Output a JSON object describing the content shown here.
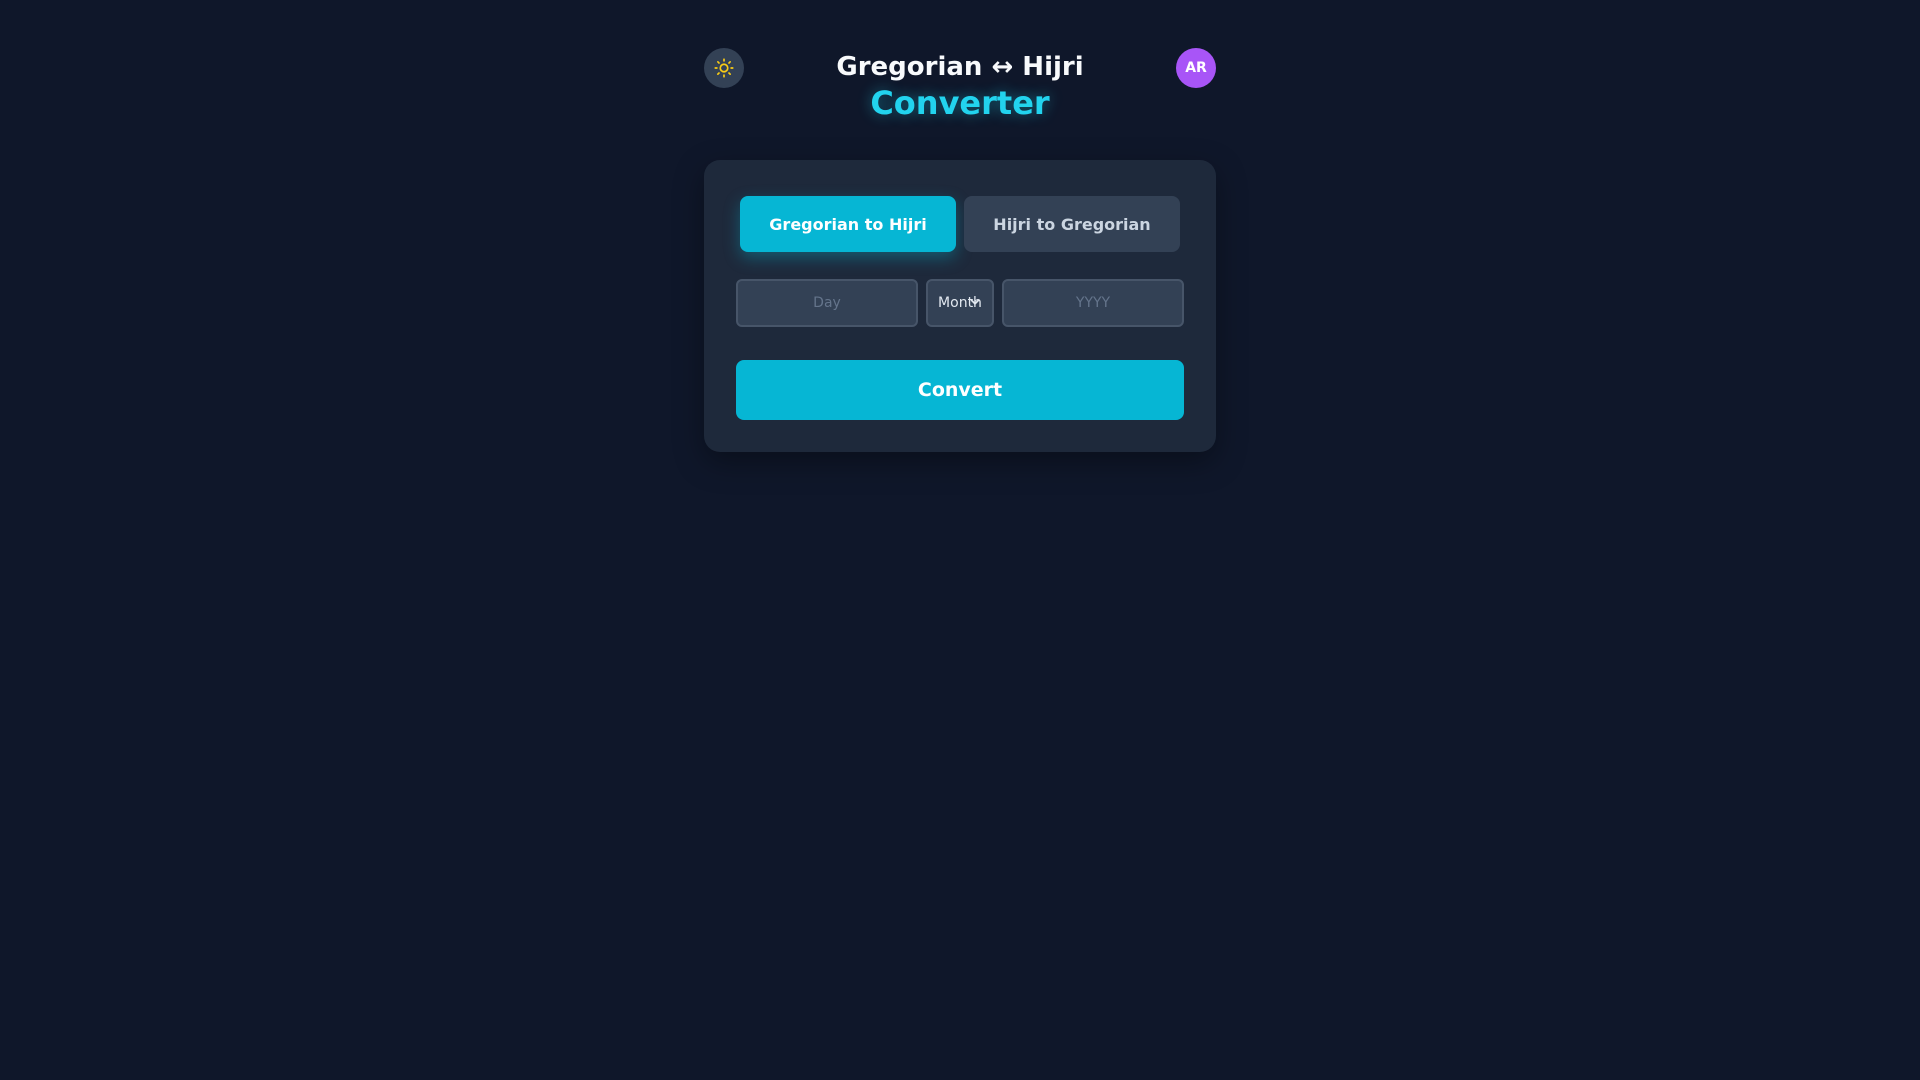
{
  "header": {
    "title_line1": "Gregorian ↔ Hijri",
    "title_line2": "Converter",
    "theme_toggle_icon": "sun-icon",
    "avatar_initials": "AR"
  },
  "tabs": [
    {
      "label": "Gregorian to Hijri",
      "active": true
    },
    {
      "label": "Hijri to Gregorian",
      "active": false
    }
  ],
  "form": {
    "day_placeholder": "Day",
    "day_value": "",
    "month_selected": "Month",
    "year_placeholder": "YYYY",
    "year_value": "",
    "convert_label": "Convert"
  },
  "colors": {
    "background": "#0f172a",
    "card": "#1e293b",
    "accent": "#06b6d4",
    "accent_text": "#22d3ee",
    "avatar": "#a855f7",
    "sun_icon": "#facc15"
  }
}
